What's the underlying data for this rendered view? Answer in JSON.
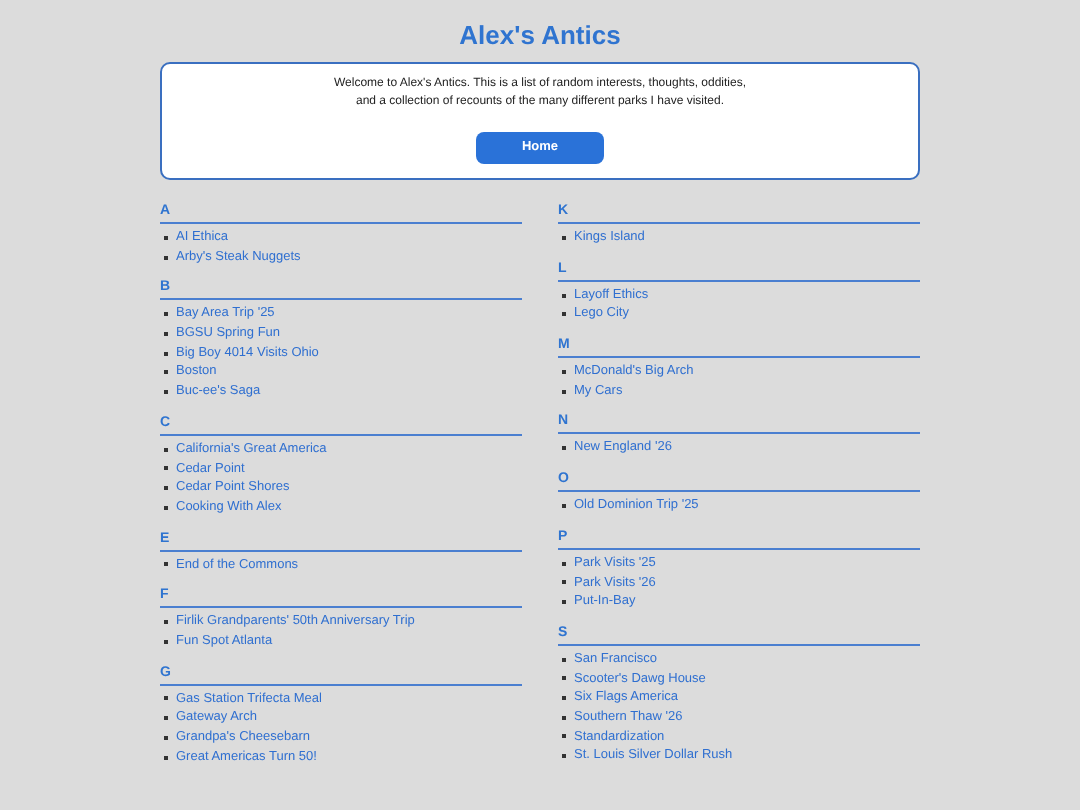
{
  "title": "Alex's Antics",
  "intro": {
    "text": "Welcome to Alex's Antics. This is a list of random interests, thoughts, oddities, and a collection of recounts of the many different parks I have visited.",
    "button": "Home"
  },
  "columns": [
    [
      {
        "letter": "A",
        "links": [
          "AI Ethica",
          "Arby's Steak Nuggets"
        ]
      },
      {
        "letter": "B",
        "links": [
          "Bay Area Trip '25",
          "BGSU Spring Fun",
          "Big Boy 4014 Visits Ohio",
          "Boston",
          "Buc-ee's Saga"
        ]
      },
      {
        "letter": "C",
        "links": [
          "California's Great America",
          "Cedar Point",
          "Cedar Point Shores",
          "Cooking With Alex"
        ]
      },
      {
        "letter": "E",
        "links": [
          "End of the Commons"
        ]
      },
      {
        "letter": "F",
        "links": [
          "Firlik Grandparents' 50th Anniversary Trip",
          "Fun Spot Atlanta"
        ]
      },
      {
        "letter": "G",
        "links": [
          "Gas Station Trifecta Meal",
          "Gateway Arch",
          "Grandpa's Cheesebarn",
          "Great Americas Turn 50!"
        ]
      }
    ],
    [
      {
        "letter": "K",
        "links": [
          "Kings Island"
        ]
      },
      {
        "letter": "L",
        "links": [
          "Layoff Ethics",
          "Lego City"
        ]
      },
      {
        "letter": "M",
        "links": [
          "McDonald's Big Arch",
          "My Cars"
        ]
      },
      {
        "letter": "N",
        "links": [
          "New England '26"
        ]
      },
      {
        "letter": "O",
        "links": [
          "Old Dominion Trip '25"
        ]
      },
      {
        "letter": "P",
        "links": [
          "Park Visits '25",
          "Park Visits '26",
          "Put-In-Bay"
        ]
      },
      {
        "letter": "S",
        "links": [
          "San Francisco",
          "Scooter's Dawg House",
          "Six Flags America",
          "Southern Thaw '26",
          "Standardization",
          "St. Louis Silver Dollar Rush"
        ]
      }
    ]
  ]
}
